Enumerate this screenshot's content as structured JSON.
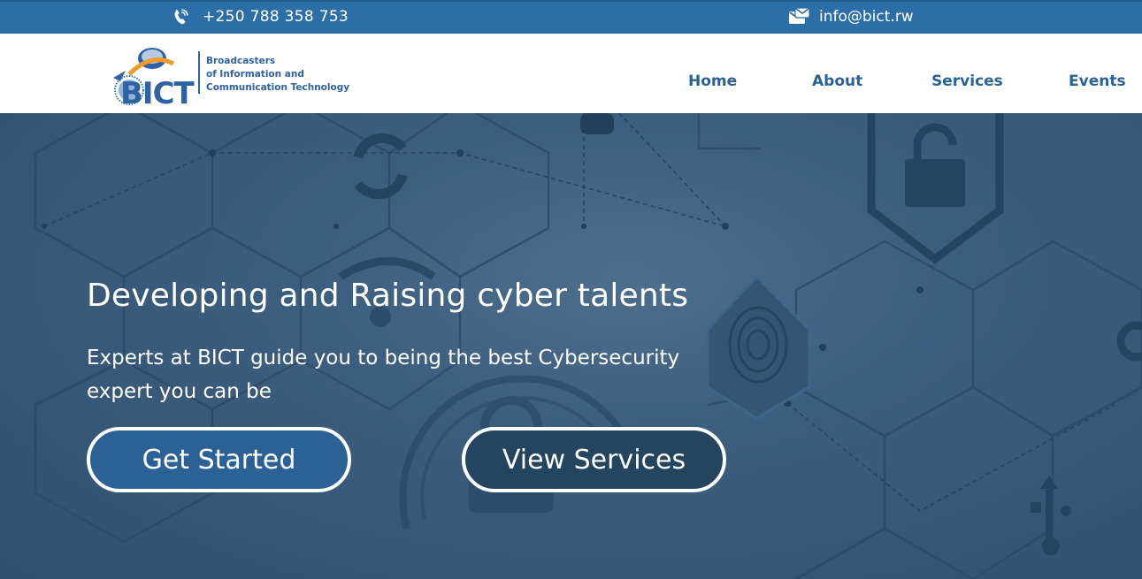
{
  "topbar": {
    "phone": "+250 788 358 753",
    "email": "info@bict.rw",
    "phone_icon": "phone-icon",
    "email_icon": "envelope-icon"
  },
  "brand": {
    "logo_text": "BICT",
    "tagline_line1": "Broadcasters",
    "tagline_line2": "of Information and",
    "tagline_line3": "Communication Technology"
  },
  "nav": {
    "items": [
      {
        "label": "Home"
      },
      {
        "label": "About"
      },
      {
        "label": "Services"
      },
      {
        "label": "Events"
      }
    ]
  },
  "hero": {
    "title": "Developing and Raising cyber talents",
    "subtitle": "Experts at BICT guide you to being the best Cybersecurity expert you can be",
    "primary_button": "Get Started",
    "secondary_button": "View Services"
  },
  "colors": {
    "topbar": "#2b6fa6",
    "nav_text": "#2a6296",
    "hero_bg": "#3d5f7e",
    "button_primary": "#2b6194"
  }
}
